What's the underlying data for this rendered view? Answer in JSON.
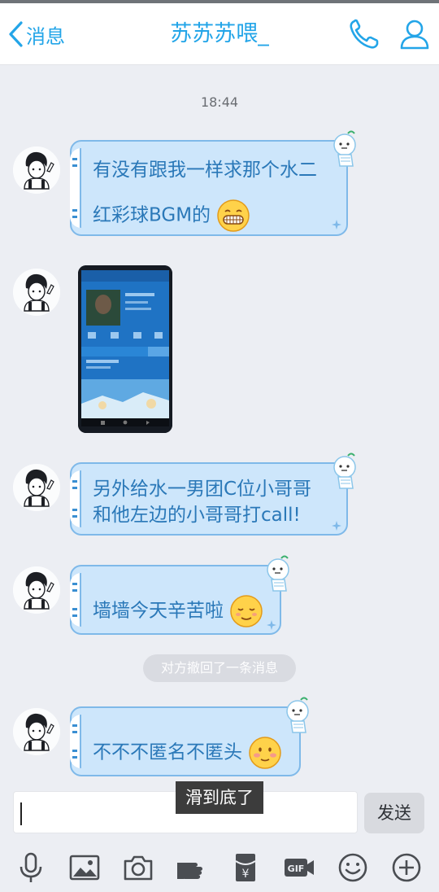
{
  "header": {
    "back_label": "消息",
    "title": "苏苏苏喂_",
    "back_icon": "chevron-left-icon",
    "phone_icon": "phone-icon",
    "profile_icon": "profile-icon"
  },
  "chat": {
    "timestamp": "18:44",
    "messages": [
      {
        "type": "text",
        "lines": [
          "有没有跟我一样求那个水二",
          "红彩球BGM的"
        ],
        "emoji": "grinning-face"
      },
      {
        "type": "image",
        "description_icon": "music-app-screenshot-image"
      },
      {
        "type": "text",
        "lines": [
          "另外给水一男团C位小哥哥",
          "和他左边的小哥哥打call!"
        ]
      },
      {
        "type": "text",
        "lines": [
          "墙墙今天辛苦啦"
        ],
        "emoji": "relieved-face"
      },
      {
        "type": "text",
        "lines": [
          "不不不匿名不匿头"
        ],
        "emoji": "blushing-face"
      }
    ],
    "recall_notice": "对方撤回了一条消息"
  },
  "input": {
    "value": "",
    "send_label": "发送",
    "toast": "滑到底了"
  },
  "toolbar": {
    "icons": [
      "microphone-icon",
      "image-icon",
      "camera-icon",
      "hand-icon",
      "red-packet-icon",
      "gif-icon",
      "emoji-icon",
      "plus-icon"
    ]
  },
  "colors": {
    "accent": "#23a5e8",
    "bubble_fill": "#cde6fb",
    "bubble_text": "#2a78b8",
    "background": "#eceef3"
  }
}
